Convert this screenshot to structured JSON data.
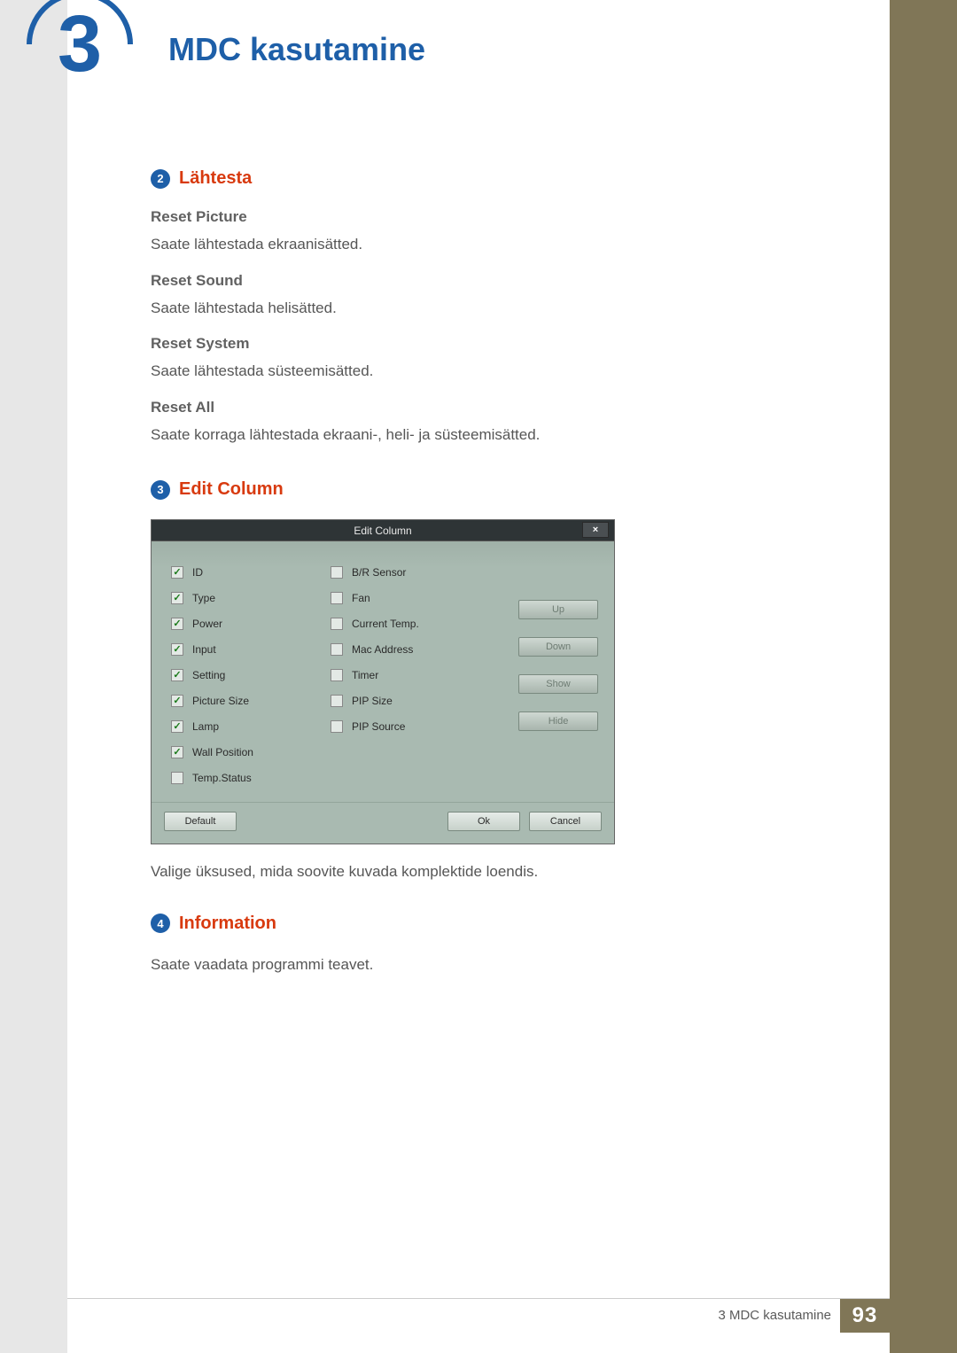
{
  "chapter": {
    "number": "3",
    "title": "MDC kasutamine"
  },
  "sections": {
    "reset": {
      "bullet": "2",
      "title": "Lähtesta",
      "items": [
        {
          "head": "Reset Picture",
          "text": "Saate lähtestada ekraanisätted."
        },
        {
          "head": "Reset Sound",
          "text": "Saate lähtestada helisätted."
        },
        {
          "head": "Reset System",
          "text": "Saate lähtestada süsteemisätted."
        },
        {
          "head": "Reset All",
          "text": "Saate korraga lähtestada ekraani-, heli- ja süsteemisätted."
        }
      ]
    },
    "editColumn": {
      "bullet": "3",
      "title": "Edit Column",
      "caption": "Valige üksused, mida soovite kuvada komplektide loendis."
    },
    "information": {
      "bullet": "4",
      "title": "Information",
      "text": "Saate vaadata programmi teavet."
    }
  },
  "dialog": {
    "title": "Edit Column",
    "close": "×",
    "col1": [
      {
        "label": "ID",
        "checked": true
      },
      {
        "label": "Type",
        "checked": true
      },
      {
        "label": "Power",
        "checked": true
      },
      {
        "label": "Input",
        "checked": true
      },
      {
        "label": "Setting",
        "checked": true
      },
      {
        "label": "Picture Size",
        "checked": true
      },
      {
        "label": "Lamp",
        "checked": true
      },
      {
        "label": "Wall Position",
        "checked": true
      },
      {
        "label": "Temp.Status",
        "checked": false
      }
    ],
    "col2": [
      {
        "label": "B/R Sensor",
        "checked": false
      },
      {
        "label": "Fan",
        "checked": false
      },
      {
        "label": "Current Temp.",
        "checked": false
      },
      {
        "label": "Mac Address",
        "checked": false
      },
      {
        "label": "Timer",
        "checked": false
      },
      {
        "label": "PIP Size",
        "checked": false
      },
      {
        "label": "PIP Source",
        "checked": false
      }
    ],
    "sideButtons": {
      "up": "Up",
      "down": "Down",
      "show": "Show",
      "hide": "Hide"
    },
    "footer": {
      "default": "Default",
      "ok": "Ok",
      "cancel": "Cancel"
    }
  },
  "footer": {
    "caption": "3 MDC kasutamine",
    "page": "93"
  }
}
